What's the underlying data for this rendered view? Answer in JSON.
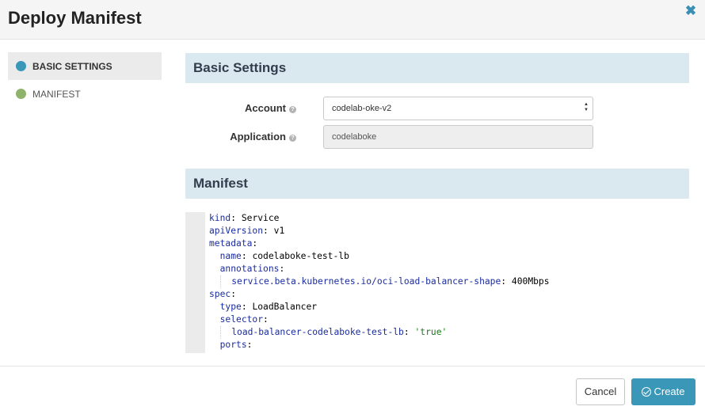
{
  "dialog": {
    "title": "Deploy Manifest",
    "close_icon": "close-icon"
  },
  "sidebar": {
    "items": [
      {
        "label": "BASIC SETTINGS",
        "active": true,
        "dot_color": "#3a97b8"
      },
      {
        "label": "MANIFEST",
        "active": false,
        "dot_color": "#8fb36a"
      }
    ]
  },
  "basic_settings": {
    "heading": "Basic Settings",
    "account": {
      "label": "Account",
      "value": "codelab-oke-v2"
    },
    "application": {
      "label": "Application",
      "value": "codelaboke"
    }
  },
  "manifest": {
    "heading": "Manifest",
    "lines": [
      {
        "indent": 0,
        "key": "kind",
        "value": "Service"
      },
      {
        "indent": 0,
        "key": "apiVersion",
        "value": "v1"
      },
      {
        "indent": 0,
        "key": "metadata",
        "value": ""
      },
      {
        "indent": 1,
        "key": "name",
        "value": "codelaboke-test-lb"
      },
      {
        "indent": 1,
        "key": "annotations",
        "value": ""
      },
      {
        "indent": 2,
        "key": "service.beta.kubernetes.io/oci-load-balancer-shape",
        "value": "400Mbps"
      },
      {
        "indent": 0,
        "key": "spec",
        "value": ""
      },
      {
        "indent": 1,
        "key": "type",
        "value": "LoadBalancer"
      },
      {
        "indent": 1,
        "key": "selector",
        "value": ""
      },
      {
        "indent": 2,
        "key": "load-balancer-codelaboke-test-lb",
        "value": "'true'",
        "string": true
      },
      {
        "indent": 1,
        "key": "ports",
        "value": ""
      }
    ]
  },
  "footer": {
    "cancel_label": "Cancel",
    "create_label": "Create",
    "create_icon": "check-circle-icon"
  },
  "colors": {
    "accent": "#3a97b8",
    "section_header_bg": "#d9e9ef"
  }
}
